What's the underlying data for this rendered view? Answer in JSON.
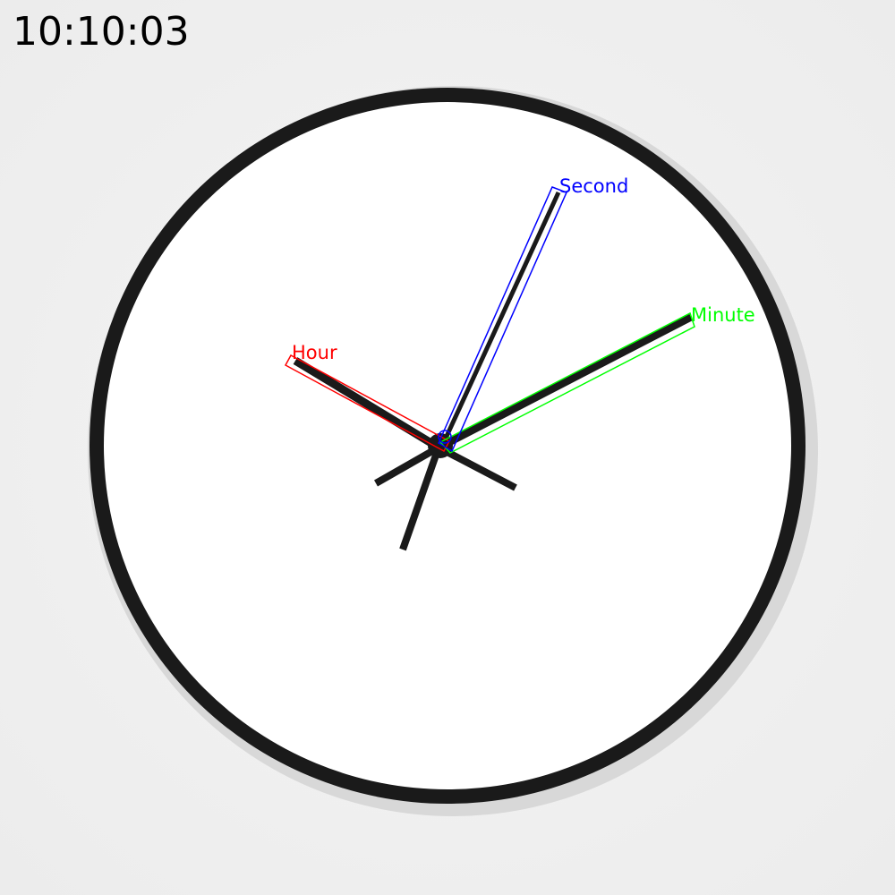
{
  "time_readout": "10:10:03",
  "clock": {
    "hours": 10,
    "minutes": 10,
    "seconds": 3,
    "face_color": "#ffffff",
    "rim_color": "#1a1a1a",
    "hand_color": "#1a1a1a"
  },
  "annotations": {
    "hour": {
      "label": "Hour",
      "color": "#ff0000"
    },
    "minute": {
      "label": "Minute",
      "color": "#00ff00"
    },
    "second": {
      "label": "Second",
      "color": "#0000ff"
    }
  }
}
